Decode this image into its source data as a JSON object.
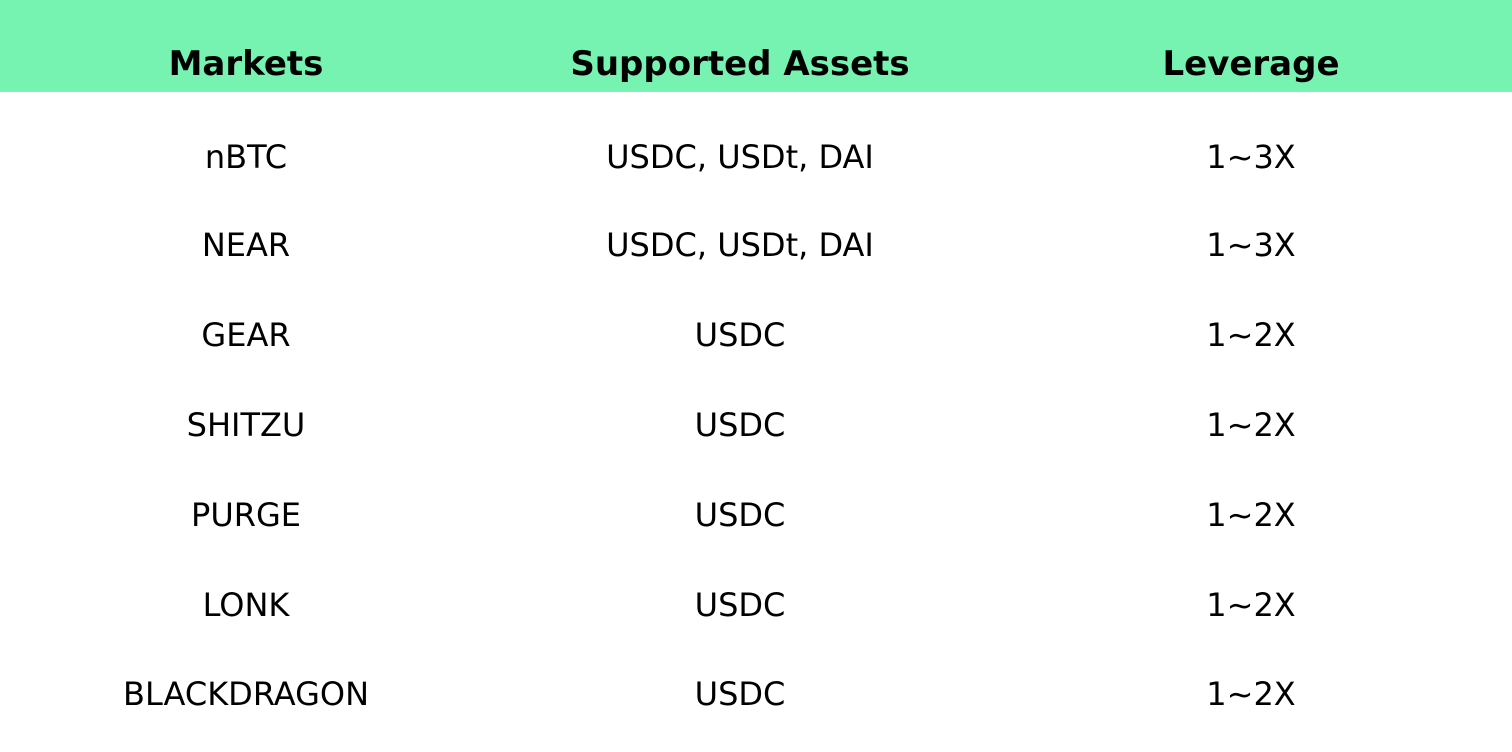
{
  "colors": {
    "header_background": "#76f3b0",
    "text": "#000000",
    "background": "#ffffff"
  },
  "table": {
    "columns": [
      "Markets",
      "Supported Assets",
      "Leverage"
    ],
    "rows": [
      {
        "market": "nBTC",
        "assets": "USDC, USDt, DAI",
        "leverage": "1~3X"
      },
      {
        "market": "NEAR",
        "assets": "USDC, USDt, DAI",
        "leverage": "1~3X"
      },
      {
        "market": "GEAR",
        "assets": "USDC",
        "leverage": "1~2X"
      },
      {
        "market": "SHITZU",
        "assets": "USDC",
        "leverage": "1~2X"
      },
      {
        "market": "PURGE",
        "assets": "USDC",
        "leverage": "1~2X"
      },
      {
        "market": "LONK",
        "assets": "USDC",
        "leverage": "1~2X"
      },
      {
        "market": "BLACKDRAGON",
        "assets": "USDC",
        "leverage": "1~2X"
      }
    ]
  }
}
